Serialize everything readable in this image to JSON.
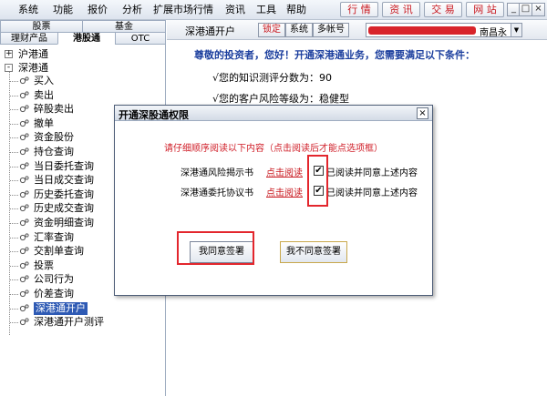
{
  "menubar": {
    "items": [
      "系统",
      "功能",
      "报价",
      "分析",
      "扩展市场行情",
      "资讯",
      "工具",
      "帮助"
    ],
    "buttons": [
      "行 情",
      "资 讯",
      "交 易",
      "网 站"
    ],
    "window_controls": [
      "_",
      "□",
      "×"
    ]
  },
  "left_panel": {
    "tabs_row1": [
      "股票",
      "基金"
    ],
    "tabs_row2": [
      "理财产品",
      "港股通",
      "OTC"
    ],
    "active_tab": "港股通",
    "tree": {
      "hugangtong": {
        "expander": "+",
        "label": "沪港通"
      },
      "shengangtong": {
        "expander": "-",
        "label": "深港通"
      },
      "items": [
        "买入",
        "卖出",
        "碎股卖出",
        "撤单",
        "资金股份",
        "持仓查询",
        "当日委托查询",
        "当日成交查询",
        "历史委托查询",
        "历史成交查询",
        "资金明细查询",
        "汇率查询",
        "交割单查询",
        "投票",
        "公司行为",
        "价差查询",
        "深港通开户",
        "深港通开户测评"
      ],
      "selected": "深港通开户"
    }
  },
  "right_panel": {
    "toolbar": {
      "title": "深港通开户",
      "lock_button": "锁定",
      "system_button": "系统",
      "multi_account_button": "多帐号",
      "account_text": "南昌永",
      "account_arrow": "▼"
    },
    "greeting": "尊敬的投资者，您好！开通深港通业务，您需要满足以下条件：",
    "conditions": [
      "√您的知识测评分数为：90",
      "√您的客户风险等级为：稳健型"
    ]
  },
  "dialog": {
    "title": "开通深股通权限",
    "close": "×",
    "instruction": "请仔细顺序阅读以下内容（点击阅读后才能点选项框）",
    "documents": [
      {
        "name": "深港通风险揭示书",
        "link": "点击阅读",
        "check": "✔",
        "agree_text": "已阅读并同意上述内容"
      },
      {
        "name": "深港通委托协议书",
        "link": "点击阅读",
        "check": "✔",
        "agree_text": "已阅读并同意上述内容"
      }
    ],
    "agree_button": "我同意签署",
    "disagree_button": "我不同意签署"
  },
  "colors": {
    "highlight_red": "#e3262d",
    "greeting_blue": "#1c3f9e",
    "instruction_red": "#d0202a",
    "tree_selected": "#2e5ab4"
  }
}
